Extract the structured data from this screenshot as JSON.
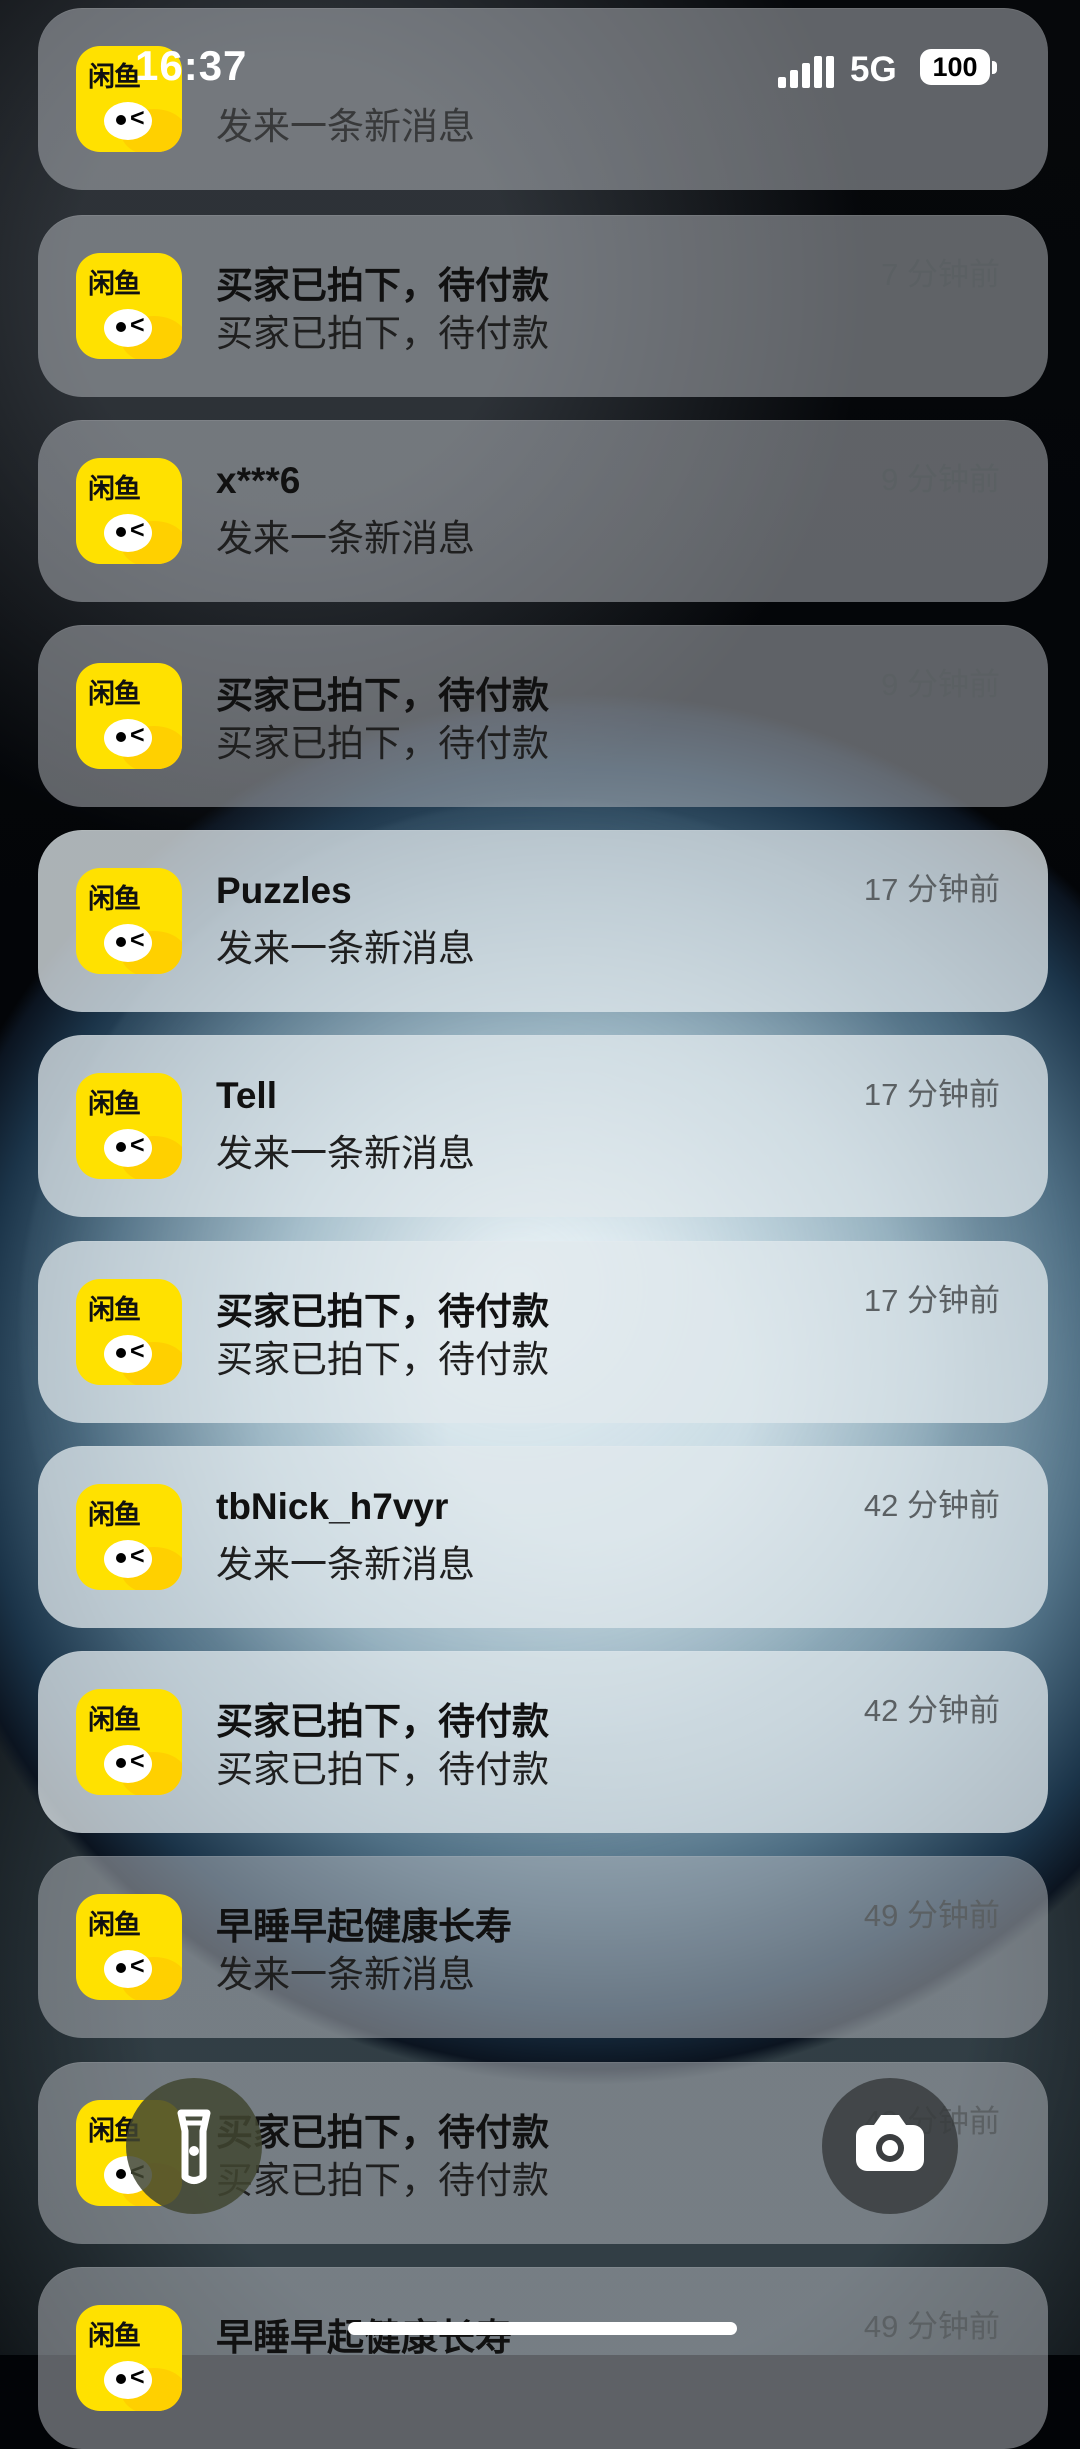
{
  "status_bar": {
    "time": "16:37",
    "network": "5G",
    "battery": "100"
  },
  "notifications": [
    {
      "title": "",
      "body": "发来一条新消息",
      "time": ""
    },
    {
      "title": "买家已拍下，待付款",
      "body": "买家已拍下，待付款",
      "time": "7 分钟前"
    },
    {
      "title": "x***6",
      "body": "发来一条新消息",
      "time": "9 分钟前"
    },
    {
      "title": "买家已拍下，待付款",
      "body": "买家已拍下，待付款",
      "time": "9 分钟前"
    },
    {
      "title": "Puzzles",
      "body": "发来一条新消息",
      "time": "17 分钟前"
    },
    {
      "title": "Tell",
      "body": "发来一条新消息",
      "time": "17 分钟前"
    },
    {
      "title": "买家已拍下，待付款",
      "body": "买家已拍下，待付款",
      "time": "17 分钟前"
    },
    {
      "title": "tbNick_h7vyr",
      "body": "发来一条新消息",
      "time": "42 分钟前"
    },
    {
      "title": "买家已拍下，待付款",
      "body": "买家已拍下，待付款",
      "time": "42 分钟前"
    },
    {
      "title": "早睡早起健康长寿",
      "body": "发来一条新消息",
      "time": "49 分钟前"
    },
    {
      "title": "买家已拍下，待付款",
      "body": "买家已拍下，待付款",
      "time": "49 分钟前"
    },
    {
      "title": "早睡早起健康长寿",
      "body": "",
      "time": "49 分钟前"
    }
  ],
  "app_icon": {
    "logo_text": "闲鱼",
    "color": "#ffe100"
  },
  "icons": {
    "flashlight": "flashlight-icon",
    "camera": "camera-icon"
  }
}
